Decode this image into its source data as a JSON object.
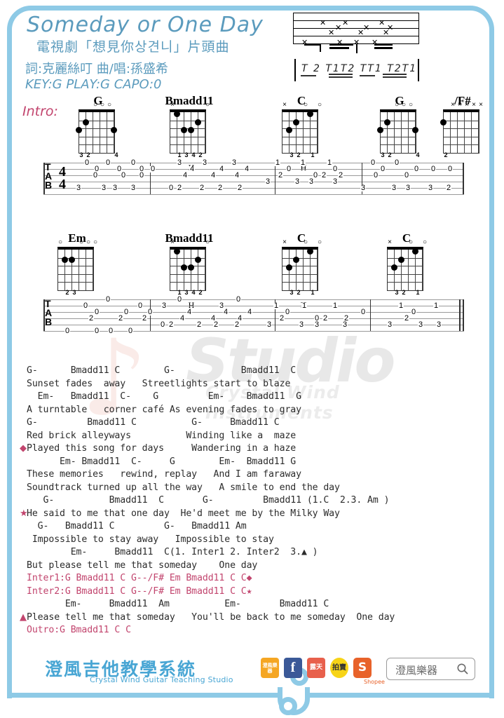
{
  "page": {
    "title": "Someday or One Day",
    "subtitle": "電視劇「想見你상견니」片頭曲",
    "credit": "詞:克麗絲叮 曲/唱:孫盛希",
    "key_line": "KEY:G PLAY:G CAPO:0",
    "intro_label": "Intro:",
    "accent_blue": "#5b9bbd",
    "accent_pink": "#c2456e",
    "frame_color": "#8ecae6"
  },
  "strum": {
    "pattern_text": "T 2 T1T2 TT1 T2T1"
  },
  "chord_rows": [
    {
      "row": 1,
      "chords": [
        {
          "name": "G",
          "marks": [
            "",
            "o",
            "o",
            "o",
            "",
            ""
          ],
          "top_marks": "x x o o o",
          "dots": [
            {
              "string": 6,
              "fret": 3
            },
            {
              "string": 5,
              "fret": 2
            },
            {
              "string": 1,
              "fret": 3
            }
          ],
          "fingers": [
            "3",
            "2",
            "",
            "",
            "",
            "4"
          ],
          "finger_text": "3 2      4",
          "h": ""
        },
        {
          "name": "Bmadd11",
          "top_marks": "x        o",
          "dots": [
            {
              "string": 5,
              "fret": 1
            },
            {
              "string": 4,
              "fret": 3
            },
            {
              "string": 3,
              "fret": 3
            },
            {
              "string": 2,
              "fret": 2
            }
          ],
          "finger_text": "1 3 4 2",
          "h": "H"
        },
        {
          "name": "C",
          "top_marks": "x   o  o",
          "dots": [
            {
              "string": 5,
              "fret": 3
            },
            {
              "string": 4,
              "fret": 2
            },
            {
              "string": 2,
              "fret": 1
            }
          ],
          "finger_text": "3 2   1",
          "h": "H"
        },
        {
          "name": "G",
          "top_marks": "o o o",
          "dots": [
            {
              "string": 6,
              "fret": 3
            },
            {
              "string": 5,
              "fret": 2
            },
            {
              "string": 1,
              "fret": 3
            }
          ],
          "finger_text": "3 2      4",
          "h": ""
        },
        {
          "name": "/F#",
          "top_marks": "x x x x x",
          "dots": [
            {
              "string": 6,
              "fret": 2
            }
          ],
          "finger_text": "2",
          "h": ""
        }
      ]
    },
    {
      "row": 2,
      "chords": [
        {
          "name": "Em",
          "top_marks": "o     o o o",
          "dots": [
            {
              "string": 5,
              "fret": 2
            },
            {
              "string": 4,
              "fret": 2
            }
          ],
          "finger_text": "2 3",
          "h": ""
        },
        {
          "name": "Bmadd11",
          "top_marks": "x        o",
          "dots": [
            {
              "string": 5,
              "fret": 1
            },
            {
              "string": 4,
              "fret": 3
            },
            {
              "string": 3,
              "fret": 3
            },
            {
              "string": 2,
              "fret": 2
            }
          ],
          "finger_text": "1 3 4 2",
          "h": "H"
        },
        {
          "name": "C",
          "top_marks": "x   o  o",
          "dots": [
            {
              "string": 5,
              "fret": 3
            },
            {
              "string": 4,
              "fret": 2
            },
            {
              "string": 2,
              "fret": 1
            }
          ],
          "finger_text": "3 2   1",
          "h": "H"
        },
        {
          "name": "C",
          "top_marks": "x   o  o",
          "dots": [
            {
              "string": 5,
              "fret": 3
            },
            {
              "string": 4,
              "fret": 2
            },
            {
              "string": 2,
              "fret": 1
            }
          ],
          "finger_text": "3 2   1",
          "h": ""
        }
      ]
    }
  ],
  "tab_staves": [
    {
      "id": "tab-line-1",
      "time_signature": "4/4",
      "label": "TAB",
      "measures": [
        {
          "notes": "0 0 0 / 0 0 0 0 / 0 0 / 3 3 3 3"
        },
        {
          "notes": "3 3 3 / 4 4 4 4 / 4 4 4 / 0 2 2 2 2"
        },
        {
          "notes": "1 1 1 / 0 0 / 2 0 2 2 / 3 3 3 3"
        },
        {
          "notes": "0 0 / 0 0 0 0 / 0 0 / 3 3 3 3 2"
        }
      ]
    },
    {
      "id": "tab-line-2",
      "label": "TAB",
      "measures": [
        {
          "notes": "0 0 0 / 0 0 0 / 2 2 2 / 0 0 0 0"
        },
        {
          "notes": "3 3 / 4 4 4 4 / 4 4 / 0 2 2 2 2"
        },
        {
          "notes": "1 1 1 / 0 0 / 2 0 2 3 3 3"
        },
        {
          "notes": "1 1 / 0 / 2 / 3 3 3"
        }
      ]
    }
  ],
  "lyrics": [
    {
      "type": "chord",
      "text": "G-      Bmadd11 C        G-            Bmadd11  C"
    },
    {
      "type": "lyric",
      "text": "Sunset fades  away   Streetlights start to blaze"
    },
    {
      "type": "chord",
      "text": "  Em-   Bmadd11  C-    G         Em-    Bmadd11  G"
    },
    {
      "type": "lyric",
      "text": "A turntable   corner café As evening fades to gray"
    },
    {
      "type": "chord",
      "text": "G-         Bmadd11 C          G-     Bmadd11 C"
    },
    {
      "type": "lyric",
      "text": "Red brick alleyways          Winding like a  maze"
    },
    {
      "type": "lyric",
      "marker": "diamond",
      "text": "Played this song for days     Wandering in a haze"
    },
    {
      "type": "chord",
      "text": "      Em- Bmadd11  C-     G        Em-  Bmadd11 G"
    },
    {
      "type": "lyric",
      "text": "These memories   rewind, replay   And I am faraway"
    },
    {
      "type": "lyric",
      "text": "Soundtrack turned up all the way   A smile to end the day"
    },
    {
      "type": "chord",
      "text": "   G-          Bmadd11  C       G-         Bmadd11 (1.C  2.3. Am )",
      "pinkpart": "(1.C  2.3. Am )"
    },
    {
      "type": "lyric",
      "marker": "star",
      "text": "He said to me that one day  He'd meet me by the Milky Way"
    },
    {
      "type": "chord",
      "text": "  G-   Bmadd11 C         G-   Bmadd11 Am"
    },
    {
      "type": "lyric",
      "text": " Impossible to stay away   Impossible to stay"
    },
    {
      "type": "chord",
      "text": "        Em-     Bmadd11  C(1. Inter1 2. Inter2  3.▲ )"
    },
    {
      "type": "lyric",
      "text": "But please tell me that someday    One day"
    },
    {
      "type": "pink",
      "text": "Inter1:G Bmadd11 C G--/F# Em Bmadd11 C C◆"
    },
    {
      "type": "pink",
      "text": "Inter2:G Bmadd11 C G--/F# Em Bmadd11 C C★"
    },
    {
      "type": "chord",
      "text": "       Em-     Bmadd11  Am          Em-       Bmadd11 C"
    },
    {
      "type": "lyric",
      "marker": "triangle",
      "text": "Please tell me that someday   You'll be back to me someday  One day"
    },
    {
      "type": "pink",
      "text": "Outro:G Bmadd11 C C"
    }
  ],
  "footer": {
    "logo_cn": "澄風吉他教學系統",
    "logo_en": "Crystal Wind Guitar Teaching Studio",
    "search_value": "澄風樂器",
    "search_icon": "search-icon",
    "shopee_label": "Shopee",
    "social": [
      {
        "name": "yahoo-store-icon",
        "label": "澄風樂器",
        "color": "#f5a623"
      },
      {
        "name": "facebook-icon",
        "label": "f",
        "color": "#3b5998"
      },
      {
        "name": "ruten-icon",
        "label": "露天",
        "color": "#e8604c"
      },
      {
        "name": "pchome-icon",
        "label": "拍賣",
        "color": "#f7d417"
      },
      {
        "name": "shopee-icon",
        "label": "S",
        "color": "#e8622a"
      }
    ]
  }
}
